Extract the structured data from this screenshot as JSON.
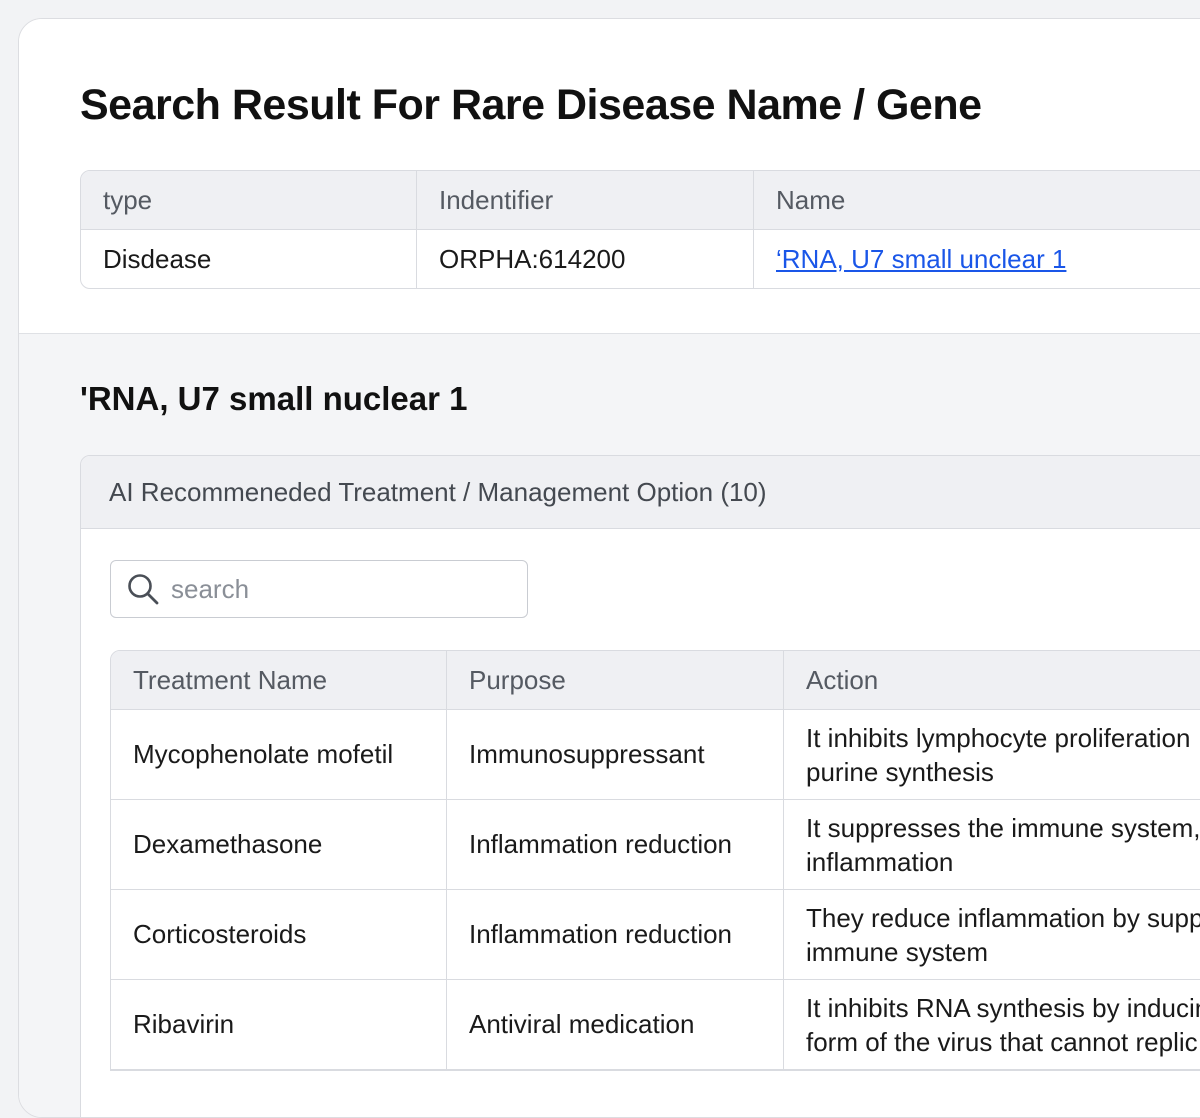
{
  "page": {
    "title": "Search Result For Rare Disease Name / Gene"
  },
  "result_table": {
    "headers": [
      "type",
      "Indentifier",
      "Name"
    ],
    "rows": [
      [
        "Disdease",
        "ORPHA:614200",
        "‘RNA, U7 small unclear 1"
      ]
    ]
  },
  "detail": {
    "title": "'RNA, U7 small nuclear 1",
    "panel_title": "AI Recommeneded Treatment / Management Option (10)",
    "search_placeholder": "search",
    "treatment_table": {
      "headers": [
        "Treatment Name",
        "Purpose",
        "Action"
      ],
      "rows": [
        [
          "Mycophenolate mofetil",
          "Immunosuppressant",
          "It inhibits lymphocyte proliferation",
          "purine synthesis"
        ],
        [
          "Dexamethasone",
          "Inflammation reduction",
          "It suppresses the immune system,",
          "inflammation"
        ],
        [
          "Corticosteroids",
          "Inflammation reduction",
          "They reduce inflammation by supp",
          "immune system"
        ],
        [
          "Ribavirin",
          "Antiviral medication",
          "It inhibits RNA synthesis by inducin",
          "form of the virus that cannot replic"
        ]
      ]
    }
  },
  "colors": {
    "link": "#1a56e8",
    "header_bg": "#eff0f3",
    "section_bg": "#f4f5f7",
    "border": "#d9dbe0"
  },
  "icons": {
    "search": "search-icon"
  }
}
